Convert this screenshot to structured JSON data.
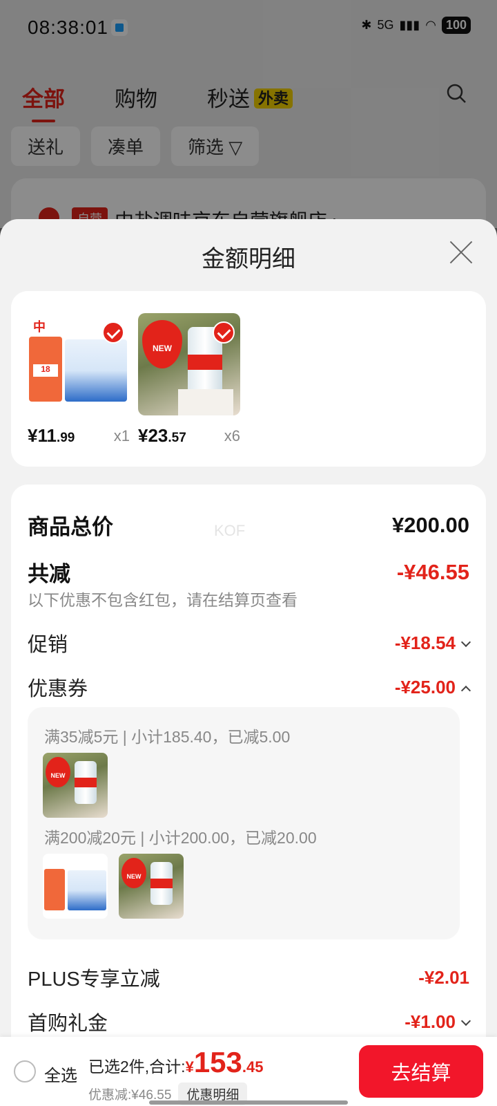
{
  "status_bar": {
    "time": "08:38:01",
    "network": "5G",
    "battery": "100"
  },
  "background": {
    "tabs": [
      "全部",
      "购物",
      "秒送"
    ],
    "waimai_badge": "外卖",
    "chips": [
      "送礼",
      "凑单",
      "筛选"
    ],
    "store_tag": "自营",
    "store_name": "中盐调味京东自营旗舰店 ›"
  },
  "sheet": {
    "title": "金额明细",
    "products": [
      {
        "price_int": "¥11",
        "price_dec": ".99",
        "qty": "x1"
      },
      {
        "price_int": "¥23",
        "price_dec": ".57",
        "qty": "x6"
      }
    ],
    "watermark": "KOF",
    "total_label": "商品总价",
    "total_value": "¥200.00",
    "reduce_label": "共减",
    "reduce_value": "-¥46.55",
    "note": "以下优惠不包含红包，请在结算页查看",
    "promo_label": "促销",
    "promo_value": "-¥18.54",
    "coupon_label": "优惠券",
    "coupon_value": "-¥25.00",
    "coupons": [
      {
        "text": "满35减5元 | 小计185.40，已减5.00"
      },
      {
        "text": "满200减20元 | 小计200.00，已减20.00"
      }
    ],
    "plus_label": "PLUS专享立减",
    "plus_value": "-¥2.01",
    "first_label": "首购礼金",
    "first_value": "-¥1.00"
  },
  "bottom_bar": {
    "select_all": "全选",
    "selected_text": "已选2件,合计:",
    "currency": "¥",
    "total_int": "153",
    "total_dec": ".45",
    "discount_text": "优惠减:¥46.55",
    "detail_button": "优惠明细",
    "checkout_button": "去结算"
  },
  "colors": {
    "accent": "#e2231a",
    "checkout": "#f2162a"
  }
}
